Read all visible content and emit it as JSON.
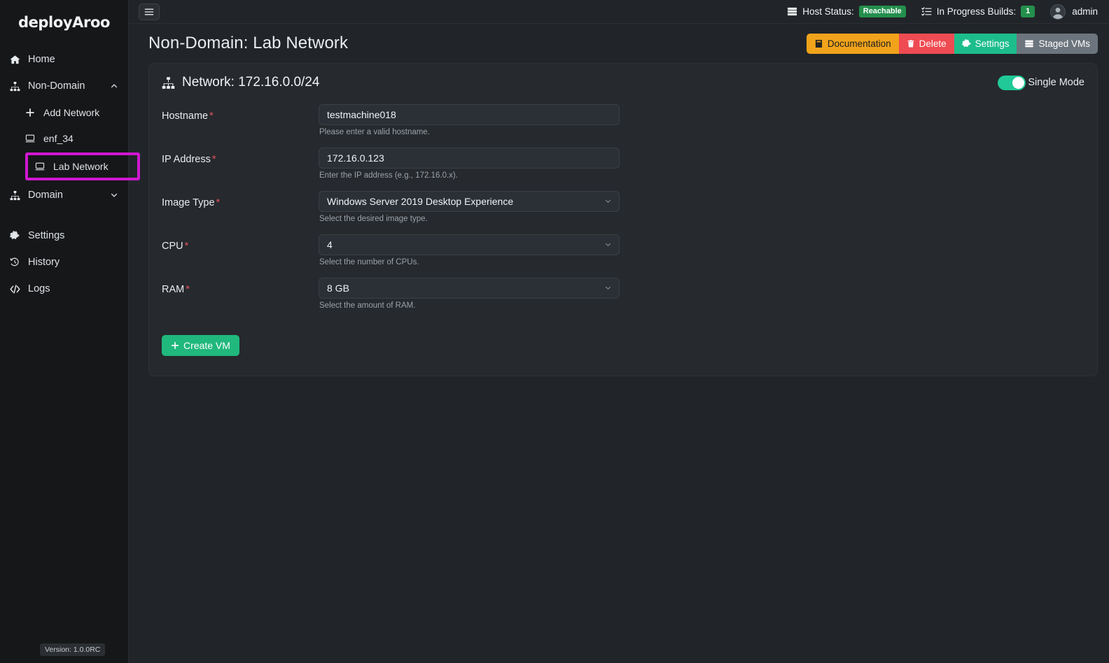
{
  "brand": {
    "name": "deployAroo"
  },
  "sidebar": {
    "items": [
      {
        "label": "Home",
        "icon": "home-icon"
      },
      {
        "label": "Non-Domain",
        "icon": "sitemap-icon",
        "chevron": "chevron-up-icon"
      },
      {
        "label": "Add Network",
        "icon": "plus-icon"
      },
      {
        "label": "enf_34",
        "icon": "display-icon"
      },
      {
        "label": "Lab Network",
        "icon": "display-icon"
      },
      {
        "label": "Domain",
        "icon": "sitemap-icon",
        "chevron": "chevron-down-icon"
      },
      {
        "label": "Settings",
        "icon": "gear-icon"
      },
      {
        "label": "History",
        "icon": "clock-rotate-icon"
      },
      {
        "label": "Logs",
        "icon": "code-icon"
      }
    ],
    "version": "Version: 1.0.0RC",
    "highlight_color": "#d017d0"
  },
  "topbar": {
    "menu_icon": "hamburger-icon",
    "host_status_label": "Host Status:",
    "host_status_value": "Reachable",
    "builds_label": "In Progress Builds:",
    "builds_value": "1",
    "user": "admin"
  },
  "page": {
    "title": "Non-Domain: Lab Network",
    "actions": [
      {
        "label": "Documentation",
        "icon": "book-icon",
        "color": "#f0a31b"
      },
      {
        "label": "Delete",
        "icon": "trash-icon",
        "color": "#ef4b52"
      },
      {
        "label": "Settings",
        "icon": "gear-icon",
        "color": "#1cbd8b"
      },
      {
        "label": "Staged VMs",
        "icon": "server-icon",
        "color": "#6c757d"
      }
    ]
  },
  "card": {
    "title": "Network: 172.16.0.0/24",
    "title_icon": "sitemap-icon",
    "toggle_label": "Single Mode",
    "toggle_on": true
  },
  "form": {
    "fields": [
      {
        "label": "Hostname",
        "required": true,
        "type": "text",
        "value": "testmachine018",
        "placeholder": "",
        "help": "Please enter a valid hostname."
      },
      {
        "label": "IP Address",
        "required": true,
        "type": "text",
        "value": "172.16.0.123",
        "placeholder": "",
        "help": "Enter the IP address (e.g., 172.16.0.x)."
      },
      {
        "label": "Image Type",
        "required": true,
        "type": "select",
        "value": "Windows Server 2019 Desktop Experience",
        "help": "Select the desired image type."
      },
      {
        "label": "CPU",
        "required": true,
        "type": "select",
        "value": "4",
        "help": "Select the number of CPUs."
      },
      {
        "label": "RAM",
        "required": true,
        "type": "select",
        "value": "8 GB",
        "help": "Select the amount of RAM."
      }
    ],
    "submit_label": "Create VM",
    "submit_icon": "plus-icon"
  }
}
